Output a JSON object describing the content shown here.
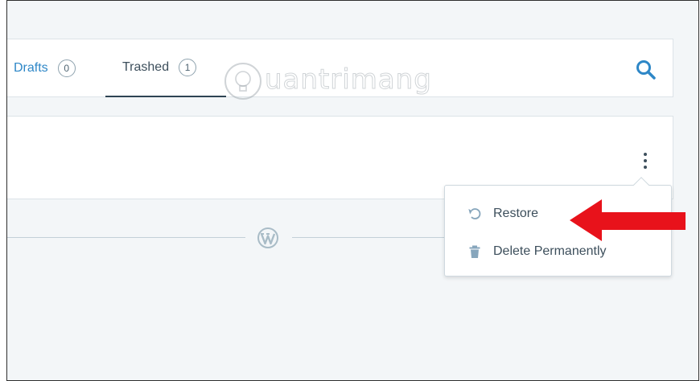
{
  "tabs": [
    {
      "label": "Drafts",
      "count": "0"
    },
    {
      "label": "Trashed",
      "count": "1"
    }
  ],
  "watermark": {
    "text": "uantrimang"
  },
  "menu": {
    "restore_label": "Restore",
    "delete_label": "Delete Permanently"
  },
  "icons": {
    "search": "search-icon",
    "more": "ellipsis-vertical-icon",
    "restore": "undo-icon",
    "delete": "trash-icon",
    "brand": "wordpress-logo-icon",
    "watermark": "lightbulb-icon"
  },
  "colors": {
    "accent": "#2e87c7",
    "text": "#3d4f5c",
    "background": "#f3f6f8",
    "annotation_arrow": "#e8121b"
  }
}
